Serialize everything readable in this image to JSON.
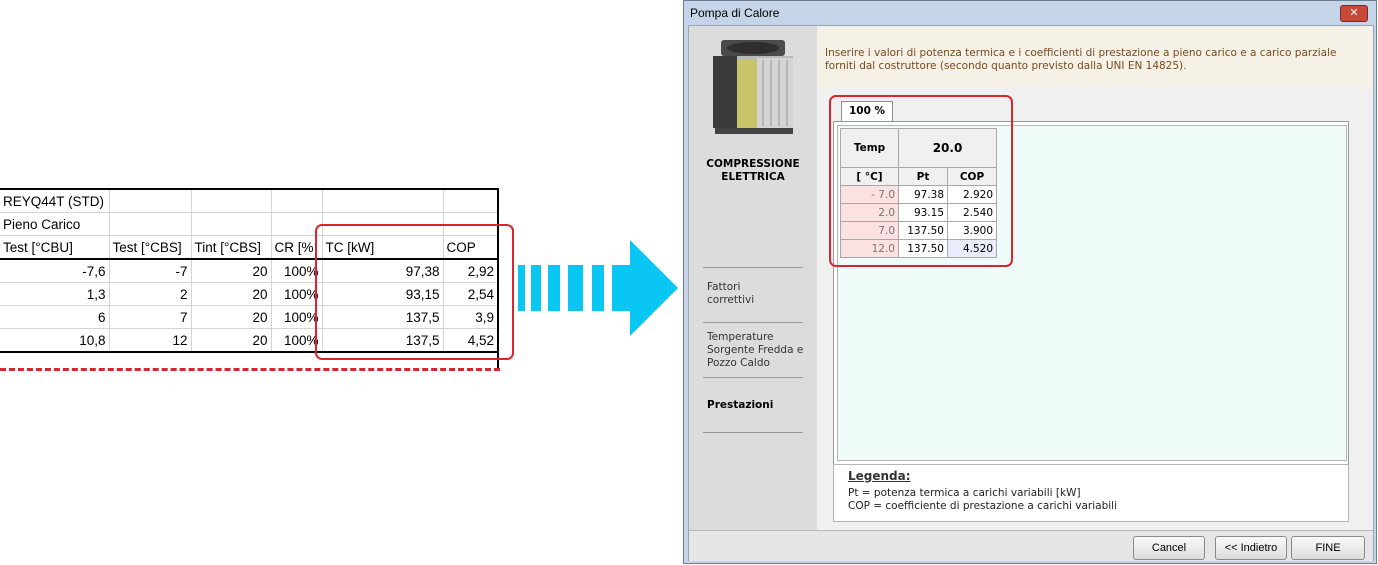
{
  "spreadsheet": {
    "title": "REYQ44T (STD)",
    "subtitle": "Pieno Carico",
    "headers": [
      "Test [°CBU]",
      "Test [°CBS]",
      "Tint [°CBS]",
      "CR [%",
      "TC [kW]",
      "COP"
    ],
    "rows": [
      [
        "-7,6",
        "-7",
        "20",
        "100%",
        "97,38",
        "2,92"
      ],
      [
        "1,3",
        "2",
        "20",
        "100%",
        "93,15",
        "2,54"
      ],
      [
        "6",
        "7",
        "20",
        "100%",
        "137,5",
        "3,9"
      ],
      [
        "10,8",
        "12",
        "20",
        "100%",
        "137,5",
        "4,52"
      ]
    ]
  },
  "window": {
    "title": "Pompa di Calore",
    "close": "✕"
  },
  "sidebar": {
    "device_label": "COMPRESSIONE ELETTRICA",
    "items": [
      {
        "label": "Fattori correttivi"
      },
      {
        "label": "Temperature Sorgente Fredda e Pozzo Caldo"
      },
      {
        "label": "Prestazioni"
      }
    ]
  },
  "info": {
    "text": "Inserire i valori di potenza termica e i coefficienti di prestazione a pieno carico e a carico parziale forniti dal costruttore (secondo quanto previsto dalla UNI EN 14825)."
  },
  "tabs": [
    {
      "label": "100 %"
    }
  ],
  "grid": {
    "temp_header": "Temp",
    "temp_value": "20.0",
    "unit": "[ °C]",
    "col_pt": "Pt",
    "col_cop": "COP",
    "rows": [
      {
        "t": "- 7.0",
        "pt": "97.38",
        "cop": "2.920"
      },
      {
        "t": "2.0",
        "pt": "93.15",
        "cop": "2.540"
      },
      {
        "t": "7.0",
        "pt": "137.50",
        "cop": "3.900"
      },
      {
        "t": "12.0",
        "pt": "137.50",
        "cop": "4.520"
      }
    ]
  },
  "legend": {
    "title": "Legenda:",
    "line1": "Pt = potenza termica a carichi variabili [kW]",
    "line2": "COP = coefficiente di prestazione a carichi variabili"
  },
  "buttons": {
    "cancel": "Cancel",
    "back": "<< Indietro",
    "finish": "FINE"
  },
  "colors": {
    "highlight": "#d9262c",
    "arrow": "#0ac6f2",
    "temp_cell": "#fbe1e1"
  }
}
